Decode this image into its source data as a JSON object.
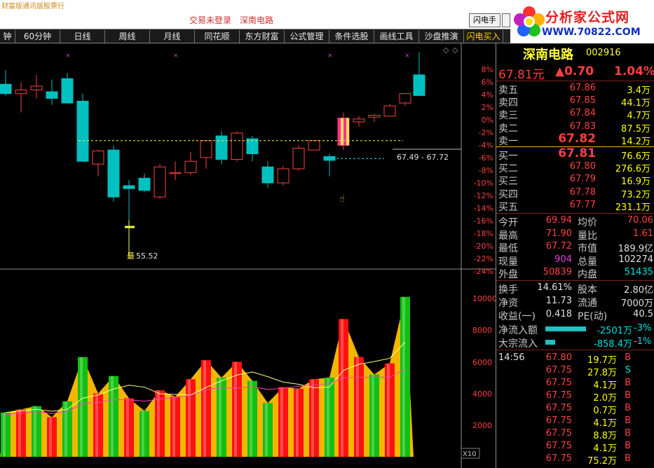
{
  "topbar": {
    "left_text": "财富版通讯版股票行",
    "status": "交易未登录",
    "stock_link": "深南电路",
    "flash_button": "闪电手",
    "logo_text": "分析家公式网",
    "logo_url": "WWW.70822.COM"
  },
  "tabs": [
    {
      "label": "钟"
    },
    {
      "label": "60分钟"
    },
    {
      "label": "日线"
    },
    {
      "label": "周线"
    },
    {
      "label": "月线"
    },
    {
      "label": "同花顺"
    },
    {
      "label": "东方财富"
    },
    {
      "label": "公式管理"
    },
    {
      "label": "条件选股"
    },
    {
      "label": "画线工具"
    },
    {
      "label": "沙盘推演"
    },
    {
      "label": "闪电买入"
    }
  ],
  "chart": {
    "pct_labels": [
      "8%",
      "6%",
      "4%",
      "2%",
      "0%",
      "-2%",
      "-4%",
      "-6%",
      "-8%",
      "-10%",
      "-12%",
      "-14%",
      "-16%",
      "-18%",
      "-20%",
      "-22%",
      "-24%"
    ],
    "vol_labels": [
      "10000",
      "8000",
      "6000",
      "4000",
      "2000"
    ],
    "range_label": "67.49 - 67.72",
    "low_label": "55.52",
    "low_prefix": "最",
    "x10": "X10",
    "colors": {
      "up": "#ff4040",
      "down": "#00c0c0",
      "vol_up": "#ff1010",
      "vol_down": "#10c010",
      "fill": "#ffc000"
    }
  },
  "chart_data": {
    "type": "candlestick",
    "candles": [
      {
        "o": 70.0,
        "h": 71.5,
        "l": 68.8,
        "c": 69.0
      },
      {
        "o": 69.0,
        "h": 70.2,
        "l": 67.0,
        "c": 69.4
      },
      {
        "o": 69.4,
        "h": 71.0,
        "l": 68.5,
        "c": 69.8
      },
      {
        "o": 69.2,
        "h": 70.5,
        "l": 67.8,
        "c": 68.5
      },
      {
        "o": 70.6,
        "h": 71.2,
        "l": 68.3,
        "c": 68.0
      },
      {
        "o": 68.2,
        "h": 69.0,
        "l": 62.0,
        "c": 61.8
      },
      {
        "o": 61.5,
        "h": 63.0,
        "l": 60.2,
        "c": 62.9
      },
      {
        "o": 63.0,
        "h": 63.5,
        "l": 57.5,
        "c": 58.0
      },
      {
        "o": 59.2,
        "h": 59.8,
        "l": 55.52,
        "c": 58.9
      },
      {
        "o": 60.0,
        "h": 60.5,
        "l": 58.5,
        "c": 58.7
      },
      {
        "o": 58.0,
        "h": 61.5,
        "l": 57.8,
        "c": 61.2
      },
      {
        "o": 60.5,
        "h": 61.8,
        "l": 59.8,
        "c": 60.6
      },
      {
        "o": 60.6,
        "h": 62.8,
        "l": 60.3,
        "c": 61.8
      },
      {
        "o": 62.2,
        "h": 64.0,
        "l": 61.0,
        "c": 64.0
      },
      {
        "o": 64.5,
        "h": 65.0,
        "l": 61.5,
        "c": 62.0
      },
      {
        "o": 62.0,
        "h": 65.0,
        "l": 61.8,
        "c": 64.8
      },
      {
        "o": 64.2,
        "h": 64.5,
        "l": 61.8,
        "c": 62.6
      },
      {
        "o": 61.2,
        "h": 61.8,
        "l": 59.0,
        "c": 59.5
      },
      {
        "o": 59.5,
        "h": 61.3,
        "l": 59.2,
        "c": 61.0
      },
      {
        "o": 61.0,
        "h": 63.5,
        "l": 60.8,
        "c": 63.2
      },
      {
        "o": 63.0,
        "h": 64.0,
        "l": 63.0,
        "c": 64.0
      },
      {
        "o": 62.3,
        "h": 62.6,
        "l": 60.2,
        "c": 61.9
      },
      {
        "o": 63.5,
        "h": 67.0,
        "l": 63.0,
        "c": 66.4
      },
      {
        "o": 66.0,
        "h": 66.6,
        "l": 65.5,
        "c": 66.3
      },
      {
        "o": 66.5,
        "h": 66.8,
        "l": 66.0,
        "c": 66.7
      },
      {
        "o": 66.6,
        "h": 67.9,
        "l": 66.6,
        "c": 67.7
      },
      {
        "o": 68.0,
        "h": 69.0,
        "l": 67.72,
        "c": 69.0
      },
      {
        "o": 71.0,
        "h": 73.4,
        "l": 68.8,
        "c": 68.8
      }
    ],
    "volumes": [
      {
        "v": 2800,
        "up": false
      },
      {
        "v": 3000,
        "up": true
      },
      {
        "v": 3200,
        "up": false
      },
      {
        "v": 2500,
        "up": true
      },
      {
        "v": 3500,
        "up": false
      },
      {
        "v": 6300,
        "up": false
      },
      {
        "v": 4000,
        "up": true
      },
      {
        "v": 5100,
        "up": false
      },
      {
        "v": 3700,
        "up": true
      },
      {
        "v": 2900,
        "up": false
      },
      {
        "v": 4200,
        "up": true
      },
      {
        "v": 3800,
        "up": true
      },
      {
        "v": 4900,
        "up": true
      },
      {
        "v": 6100,
        "up": true
      },
      {
        "v": 5000,
        "up": false
      },
      {
        "v": 6000,
        "up": true
      },
      {
        "v": 4800,
        "up": false
      },
      {
        "v": 3400,
        "up": false
      },
      {
        "v": 4400,
        "up": true
      },
      {
        "v": 4300,
        "up": true
      },
      {
        "v": 4900,
        "up": true
      },
      {
        "v": 5000,
        "up": false
      },
      {
        "v": 8700,
        "up": true
      },
      {
        "v": 6300,
        "up": true
      },
      {
        "v": 5200,
        "up": false
      },
      {
        "v": 5900,
        "up": true
      },
      {
        "v": 10100,
        "up": false
      }
    ],
    "ylim": [
      52,
      75
    ],
    "vol_ylim": [
      0,
      11000
    ],
    "grid": false
  },
  "quote": {
    "name": "深南电路",
    "code": "002916",
    "price": "67.81元",
    "change": "▲0.70",
    "change_pct": "1.04%",
    "asks": [
      {
        "label": "卖五",
        "price": "67.86",
        "vol": "3.4万"
      },
      {
        "label": "卖四",
        "price": "67.85",
        "vol": "44.1万"
      },
      {
        "label": "卖三",
        "price": "67.84",
        "vol": "4.7万"
      },
      {
        "label": "卖二",
        "price": "67.83",
        "vol": "87.5万"
      },
      {
        "label": "卖一",
        "price": "67.82",
        "vol": "14.2万"
      }
    ],
    "bids": [
      {
        "label": "买一",
        "price": "67.81",
        "vol": "76.6万"
      },
      {
        "label": "买二",
        "price": "67.80",
        "vol": "276.6万"
      },
      {
        "label": "买三",
        "price": "67.79",
        "vol": "16.9万"
      },
      {
        "label": "买四",
        "price": "67.78",
        "vol": "73.2万"
      },
      {
        "label": "买五",
        "price": "67.77",
        "vol": "231.1万"
      }
    ],
    "stats": [
      {
        "l1": "今开",
        "v1": "69.94",
        "l2": "均价",
        "v2": "70.06",
        "c1": "red",
        "c2": "red"
      },
      {
        "l1": "最高",
        "v1": "71.90",
        "l2": "量比",
        "v2": "1.61",
        "c1": "red",
        "c2": "red"
      },
      {
        "l1": "最低",
        "v1": "67.72",
        "l2": "市值",
        "v2": "189.9亿",
        "c1": "red",
        "c2": "wht"
      },
      {
        "l1": "现量",
        "v1": "904",
        "l2": "总量",
        "v2": "102274",
        "c1": "mag",
        "c2": "wht"
      },
      {
        "l1": "外盘",
        "v1": "50839",
        "l2": "内盘",
        "v2": "51435",
        "c1": "red",
        "c2": "grn"
      }
    ],
    "stats2": [
      {
        "l1": "换手",
        "v1": "14.61%",
        "l2": "股本",
        "v2": "2.80亿"
      },
      {
        "l1": "净资",
        "v1": "11.73",
        "l2": "流通",
        "v2": "7000万"
      },
      {
        "l1": "收益(一)",
        "v1": "0.418",
        "l2": "PE(动)",
        "v2": "40.5"
      }
    ],
    "flows": [
      {
        "label": "净流入额",
        "value": "-2501万",
        "pct": "-3%"
      },
      {
        "label": "大宗流入",
        "value": "-858.4万",
        "pct": "-1%"
      }
    ],
    "ticks": [
      {
        "time": "14:56",
        "price": "67.80",
        "vol": "19.7万",
        "side": "B"
      },
      {
        "time": "",
        "price": "67.75",
        "vol": "27.8万",
        "side": "S"
      },
      {
        "time": "",
        "price": "67.75",
        "vol": "4.1万",
        "side": "B"
      },
      {
        "time": "",
        "price": "67.75",
        "vol": "2.0万",
        "side": "B"
      },
      {
        "time": "",
        "price": "67.75",
        "vol": "0.7万",
        "side": "B"
      },
      {
        "time": "",
        "price": "67.75",
        "vol": "4.1万",
        "side": "B"
      },
      {
        "time": "",
        "price": "67.75",
        "vol": "8.8万",
        "side": "B"
      },
      {
        "time": "",
        "price": "67.75",
        "vol": "4.1万",
        "side": "B"
      },
      {
        "time": "",
        "price": "67.75",
        "vol": "75.2万",
        "side": "B"
      }
    ]
  }
}
